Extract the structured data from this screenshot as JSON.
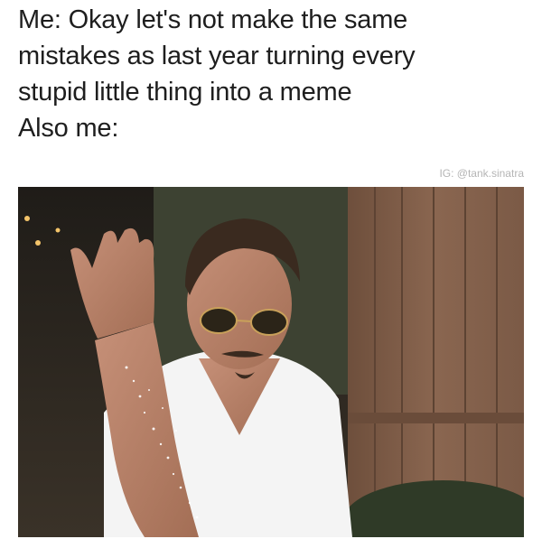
{
  "caption": {
    "line1": "Me: Okay let's not make the same",
    "line2": "mistakes as last year turning every",
    "line3": "stupid little thing into a meme",
    "line4": "Also me:"
  },
  "credit": {
    "text": "IG: @tank.sinatra"
  },
  "colors": {
    "caption_text": "#1e1e1e",
    "credit_text": "#b5b5b5",
    "fence": "#7a5a44",
    "shirt": "#f4f4f4",
    "skin": "#b98268",
    "hair": "#3a2a1f"
  }
}
